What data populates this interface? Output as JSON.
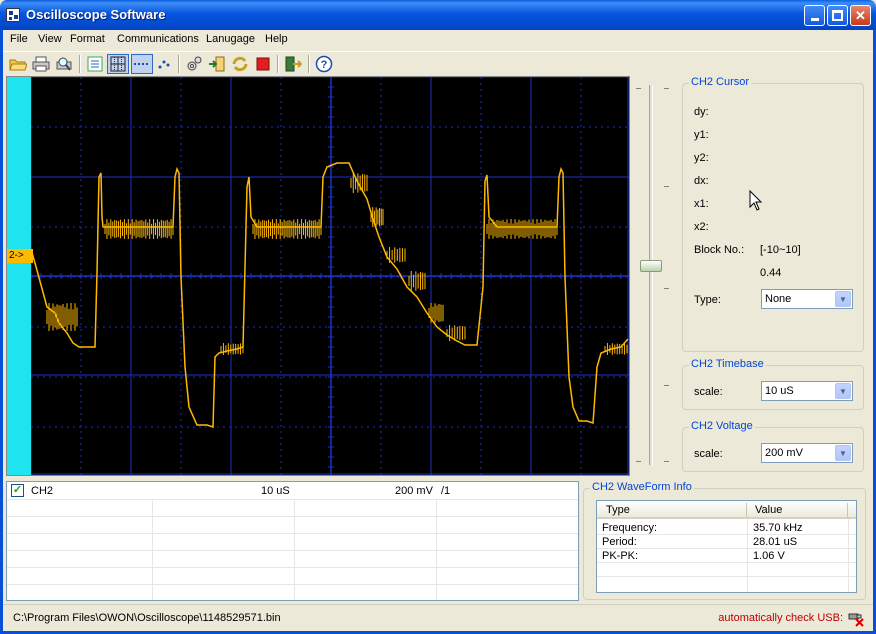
{
  "window": {
    "title": "Oscilloscope Software"
  },
  "menu": [
    "File",
    "View",
    "Format",
    "Communications",
    "Lanugage",
    "Help"
  ],
  "toolbar": {
    "icons": [
      "open-folder-icon",
      "print-icon",
      "print-preview-icon",
      "list-icon",
      "grid-icon",
      "dotted-line-icon",
      "scatter-icon",
      "settings-icon",
      "import-icon",
      "refresh-icon",
      "stop-icon",
      "export-icon",
      "help-icon"
    ]
  },
  "scope": {
    "channel_marker": "2->",
    "trace_color": "#ffba00",
    "background": "#000000",
    "grid_color": "#1a32c8"
  },
  "cursor": {
    "title": "CH2 Cursor",
    "labels": {
      "dy": "dy:",
      "y1": "y1:",
      "y2": "y2:",
      "dx": "dx:",
      "x1": "x1:",
      "x2": "x2:",
      "block": "Block No.:",
      "type": "Type:"
    },
    "block_range": "[-10~10]",
    "block_value": "0.44",
    "type_value": "None"
  },
  "timebase": {
    "title": "CH2 Timebase",
    "label": "scale:",
    "value": "10 uS"
  },
  "voltage": {
    "title": "CH2 Voltage",
    "label": "scale:",
    "value": "200 mV"
  },
  "channel_list": {
    "name": "CH2",
    "timebase": "10 uS",
    "voltage": "200 mV",
    "probe": "/1",
    "checked": true
  },
  "waveform_info": {
    "title": "CH2 WaveForm Info",
    "headers": [
      "Type",
      "Value"
    ],
    "rows": [
      {
        "type": "Frequency:",
        "value": "35.70 kHz"
      },
      {
        "type": "Period:",
        "value": "28.01 uS"
      },
      {
        "type": "PK-PK:",
        "value": "1.06 V"
      }
    ]
  },
  "status": {
    "path": "C:\\Program Files\\OWON\\Oscilloscope\\1148529571.bin",
    "usb": "automatically check USB:"
  }
}
